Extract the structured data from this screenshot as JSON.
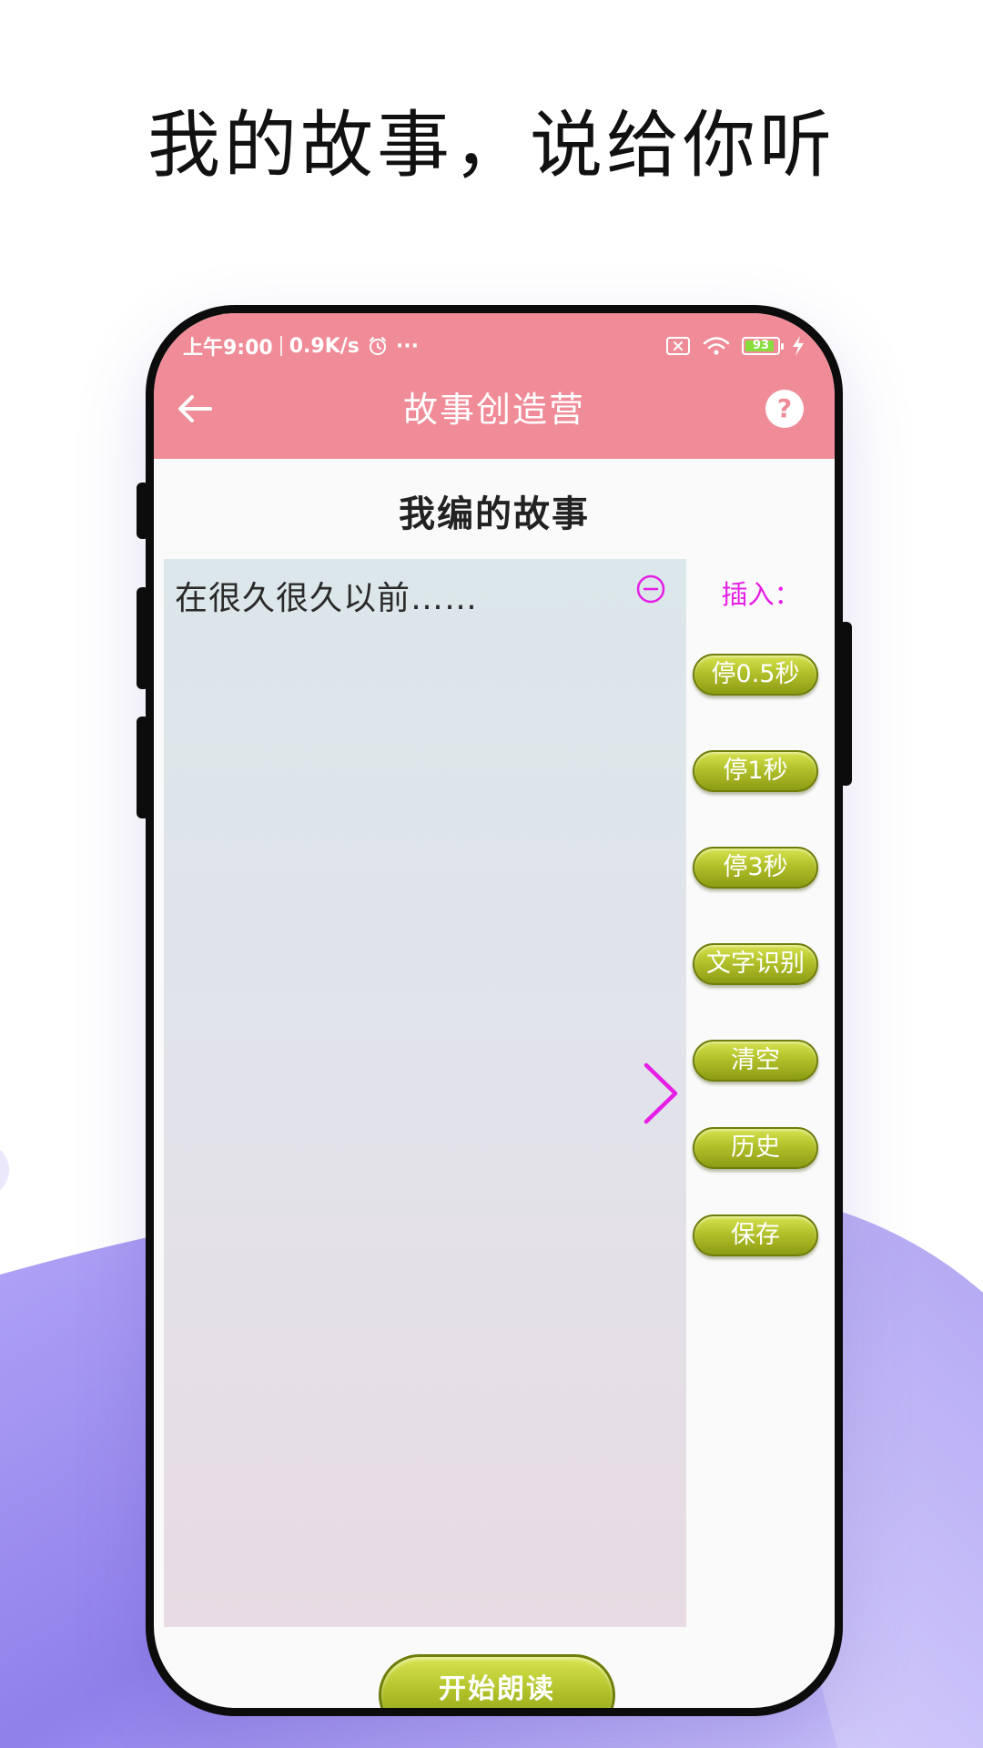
{
  "promo": {
    "headline": "我的故事，说给你听"
  },
  "status_bar": {
    "time": "上午9:00",
    "speed": "0.9K/s",
    "more": "···",
    "battery": "93",
    "battery_level": 0.93
  },
  "app_bar": {
    "title": "故事创造营",
    "help": "?"
  },
  "page": {
    "title": "我编的故事"
  },
  "editor": {
    "text": "在很久很久以前……"
  },
  "insert_panel": {
    "label": "插入：",
    "buttons": [
      {
        "label": "停0.5秒"
      },
      {
        "label": "停1秒"
      },
      {
        "label": "停3秒"
      },
      {
        "label": "文字识别"
      },
      {
        "label": "清空"
      },
      {
        "label": "历史"
      },
      {
        "label": "保存"
      }
    ]
  },
  "footer": {
    "read_label": "开始朗读"
  },
  "colors": {
    "header": "#f08c98",
    "accent_magenta": "#e61ee6",
    "button_green": "#b1c12a",
    "wave_purple": "#8f80ea"
  },
  "icons": {
    "back": "arrow-left-icon",
    "help": "question-circle-icon",
    "collapse": "minus-circle-icon",
    "expand": "chevron-right-icon",
    "alarm": "alarm-icon",
    "sim": "sim-x-icon",
    "wifi": "wifi-icon",
    "battery": "battery-icon",
    "charging": "charging-bolt-icon"
  }
}
